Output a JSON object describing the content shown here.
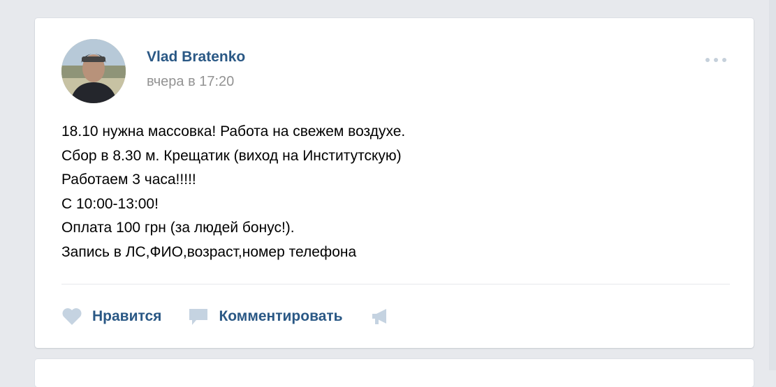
{
  "post": {
    "author": "Vlad Bratenko",
    "date": "вчера в 17:20",
    "lines": [
      "18.10 нужна массовка! Работа на свежем воздухе.",
      "Сбор в 8.30 м. Крещатик (виход на Институтскую)",
      "Работаем 3 часа!!!!!",
      "С 10:00-13:00!",
      "Оплата 100 грн (за людей бонус!).",
      "Запись в ЛС,ФИО,возраст,номер телефона"
    ],
    "actions": {
      "like_label": "Нравится",
      "comment_label": "Комментировать"
    }
  },
  "colors": {
    "link": "#2a5885",
    "muted": "#939393",
    "icon": "#c5d3e1",
    "background": "#e7e9ed"
  },
  "icons": {
    "like": "heart-icon",
    "comment": "comment-icon",
    "share": "megaphone-icon",
    "more": "more-dots-icon"
  }
}
